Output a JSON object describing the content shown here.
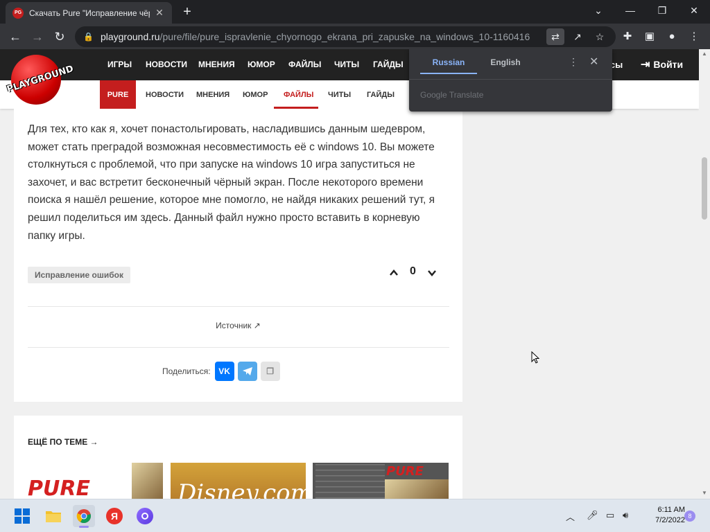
{
  "browser": {
    "tab_title": "Скачать Pure \"Исправление чёр",
    "favicon_text": "PG",
    "url_domain": "playground.ru",
    "url_path": "/pure/file/pure_ispravlenie_chyornogo_ekrana_pri_zapuske_na_windows_10-1160416"
  },
  "site": {
    "logo_text": "PLAYGROUND",
    "top_nav": [
      "ИГРЫ",
      "НОВОСТИ",
      "МНЕНИЯ",
      "ЮМОР",
      "ФАЙЛЫ",
      "ЧИТЫ",
      "ГАЙДЫ"
    ],
    "bonus_label": "усы",
    "login_label": "Войти",
    "sub_nav": {
      "game": "PURE",
      "items": [
        "НОВОСТИ",
        "МНЕНИЯ",
        "ЮМОР",
        "ФАЙЛЫ",
        "ЧИТЫ",
        "ГАЙДЫ"
      ],
      "active": "ФАЙЛЫ"
    }
  },
  "article": {
    "lines": [
      "Для тех, кто как я, хочет понастольгировать, насладившись данным шедевром,",
      "может стать преградой возможная несовместимость её с windows 10. Вы можете",
      "столкнуться с проблемой, что при запуске на windows 10 игра запуститься не",
      "захочет, и вас встретит бесконечный чёрный экран. После некоторого времени",
      "поиска я нашёл решение, которое мне помогло, не найдя никаких решений тут, я",
      "решил поделиться им здесь. Данный файл нужно просто вставить в корневую",
      "папку игры."
    ],
    "tag": "Исправление ошибок",
    "vote_count": "0",
    "source_label": "Источник",
    "share_label": "Поделиться:",
    "share_vk": "VK"
  },
  "related": {
    "heading": "ЕЩЁ ПО ТЕМЕ →",
    "thumb1_text": "PURE",
    "thumb2_text": "Disney.com",
    "thumb3_text": "PURE"
  },
  "translate_popup": {
    "tab_source": "Russian",
    "tab_target": "English",
    "brand": "Google Translate"
  },
  "taskbar": {
    "yandex_letter": "Я",
    "time": "6:11 AM",
    "date": "7/2/2022",
    "notification_count": "8"
  },
  "colors": {
    "brand_red": "#c41e1e",
    "vk_blue": "#0077ff",
    "telegram_blue": "#54a9eb",
    "chrome_dark": "#202124",
    "translate_accent": "#8ab4f8"
  }
}
